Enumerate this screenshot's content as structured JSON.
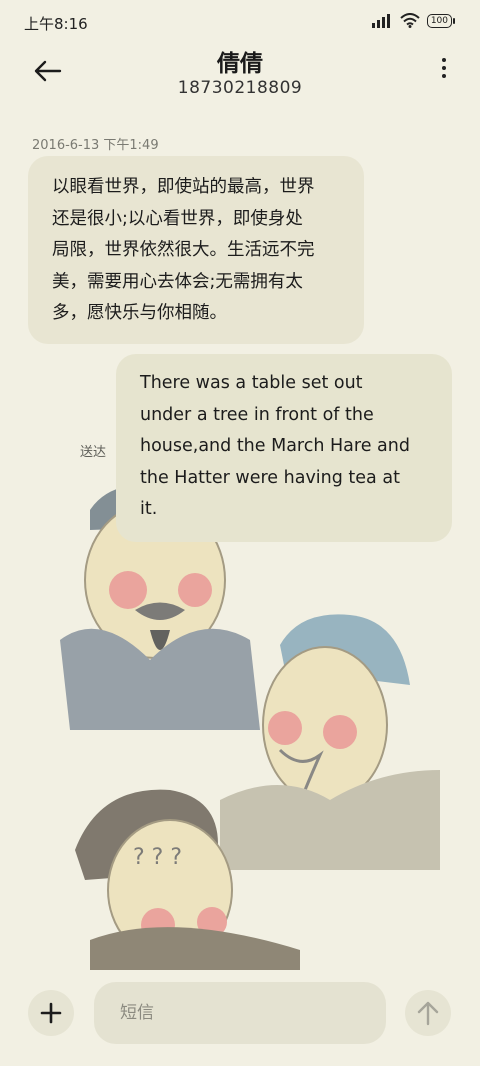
{
  "status_bar": {
    "time": "上午8:16",
    "battery": "100"
  },
  "header": {
    "contact_name": "倩倩",
    "phone_number": "18730218809"
  },
  "conversation": {
    "timestamp": "2016-6-13 下午1:49",
    "messages": [
      {
        "direction": "incoming",
        "lines": [
          "以眼看世界，即使站的最高，世界",
          "还是很小;以心看世界，即使身处",
          "局限，世界依然很大。生活远不完",
          "美，需要用心去体会;无需拥有太",
          "多，愿快乐与你相随。"
        ]
      },
      {
        "direction": "outgoing",
        "lines": [
          "There was a table set out",
          "under a tree in front of the",
          "house,and the March Hare and",
          "the Hatter were having tea at",
          "it."
        ],
        "status": "送达"
      }
    ]
  },
  "composer": {
    "placeholder": "短信"
  },
  "icons": {
    "back": "arrow-left-icon",
    "more": "more-vertical-icon",
    "add": "plus-icon",
    "send": "arrow-up-icon",
    "signal": "signal-icon",
    "wifi": "wifi-icon"
  }
}
